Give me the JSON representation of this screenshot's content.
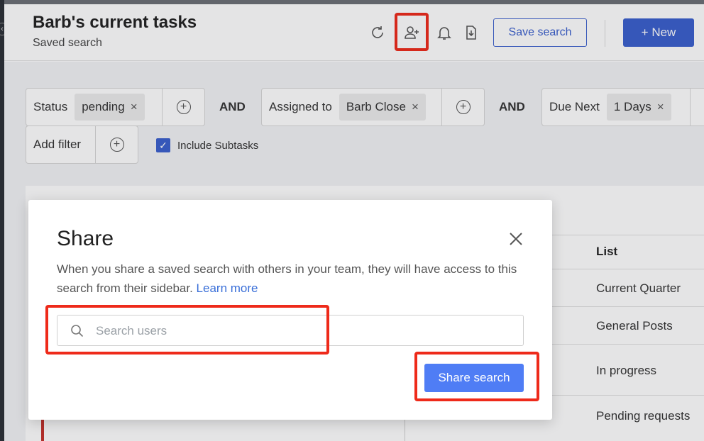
{
  "header": {
    "title": "Barb's current tasks",
    "subtitle": "Saved search",
    "icons": [
      "refresh-icon",
      "add-user-icon",
      "bell-icon",
      "download-icon"
    ],
    "save_search_label": "Save search",
    "new_label": "New",
    "new_icon": "plus-icon"
  },
  "filters": {
    "groups": [
      {
        "label": "Status",
        "value": "pending"
      },
      {
        "label": "Assigned to",
        "value": "Barb Close"
      },
      {
        "label": "Due Next",
        "value": "1 Days"
      }
    ],
    "connector": "AND",
    "add_filter_label": "Add filter",
    "include_subtasks_label": "Include Subtasks",
    "include_subtasks_checked": true
  },
  "table": {
    "list_header": "List",
    "list_values": [
      "Current Quarter",
      "General Posts",
      "In progress",
      "Pending requests"
    ]
  },
  "modal": {
    "title": "Share",
    "description": "When you share a saved search with others in your team, they will have access to this search from their sidebar.",
    "learn_more": "Learn more",
    "search_placeholder": "Search users",
    "search_value": "",
    "share_button": "Share search"
  },
  "colors": {
    "accent": "#3a5fcd",
    "share_button": "#4f7df5",
    "highlight": "#ee2a1a"
  }
}
